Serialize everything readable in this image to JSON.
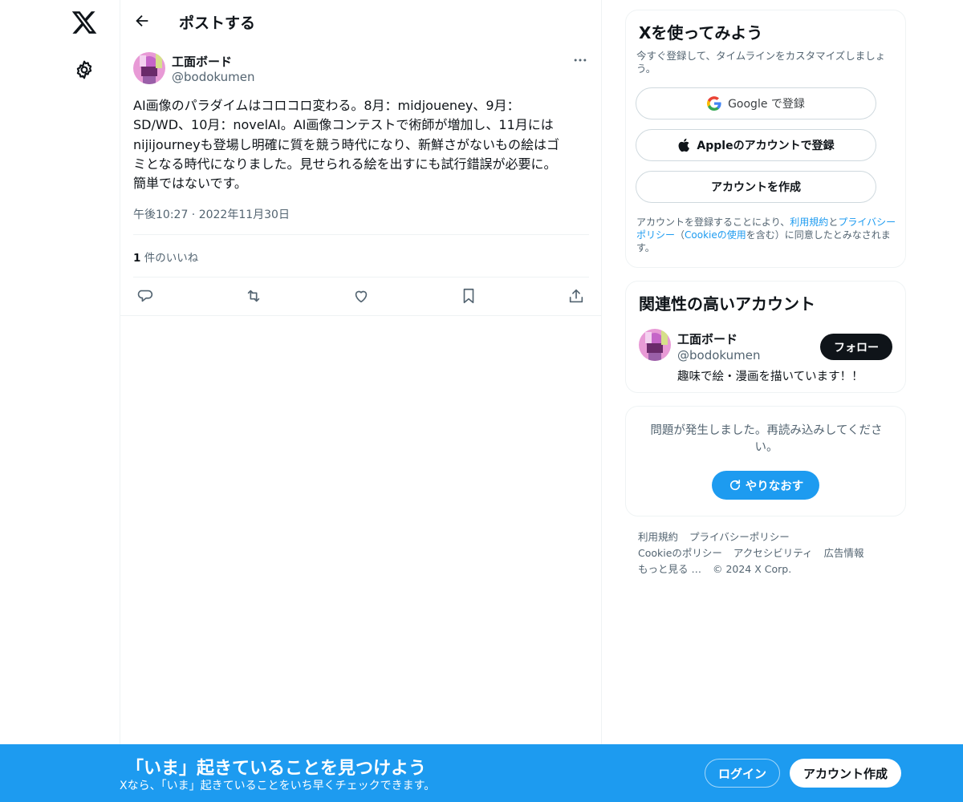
{
  "nav": {
    "logo_icon": "x-logo-icon",
    "settings_icon": "gear-icon"
  },
  "header": {
    "back_icon": "arrow-left-icon",
    "title": "ポストする"
  },
  "post": {
    "author_name": "工面ボード",
    "author_handle": "@bodokumen",
    "text": "AI画像のパラダイムはコロコロ変わる。8月：midjoueney、9月：\nSD/WD、10月：novelAI。AI画像コンテストで術師が増加し、11月には\nnijijourneyも登場し明確に質を競う時代になり、新鮮さがないもの絵はゴ\nミとなる時代になりました。見せられる絵を出すにも試行錯誤が必要に。\n簡単ではないです。",
    "timestamp": "午後10:27 · 2022年11月30日",
    "likes_count": "1",
    "likes_label": " 件のいいね",
    "actions": [
      "reply-icon",
      "repost-icon",
      "like-icon",
      "bookmark-icon",
      "share-icon"
    ]
  },
  "signup": {
    "title": "Xを使ってみよう",
    "subtitle": "今すぐ登録して、タイムラインをカスタマイズしましょう。",
    "google_label": "Google で登録",
    "apple_label": "Appleのアカウントで登録",
    "create_label": "アカウントを作成",
    "legal_prefix": "アカウントを登録することにより、",
    "legal_terms": "利用規約",
    "legal_and": "と",
    "legal_privacy": "プライバシーポリシー",
    "legal_paren_open": "（",
    "legal_cookie": "Cookieの使用",
    "legal_suffix": "を含む）に同意したとみなされます。"
  },
  "related": {
    "title": "関連性の高いアカウント",
    "name": "工面ボード",
    "handle": "@bodokumen",
    "bio": "趣味で絵・漫画を描いています！！",
    "follow_label": "フォロー"
  },
  "error": {
    "message": "問題が発生しました。再読み込みしてください。",
    "retry_label": "やりなおす"
  },
  "footer": {
    "links": [
      "利用規約",
      "プライバシーポリシー",
      "Cookieのポリシー",
      "アクセシビリティ",
      "広告情報",
      "もっと見る …",
      "© 2024 X Corp."
    ]
  },
  "bottom_bar": {
    "title": "「いま」起きていることを見つけよう",
    "subtitle": "Xなら、「いま」起きていることをいち早くチェックできます。",
    "login_label": "ログイン",
    "create_label": "アカウント作成"
  },
  "colors": {
    "accent": "#1d9bf0",
    "text": "#0f1419",
    "secondary": "#536471",
    "border": "#eff3f4"
  }
}
